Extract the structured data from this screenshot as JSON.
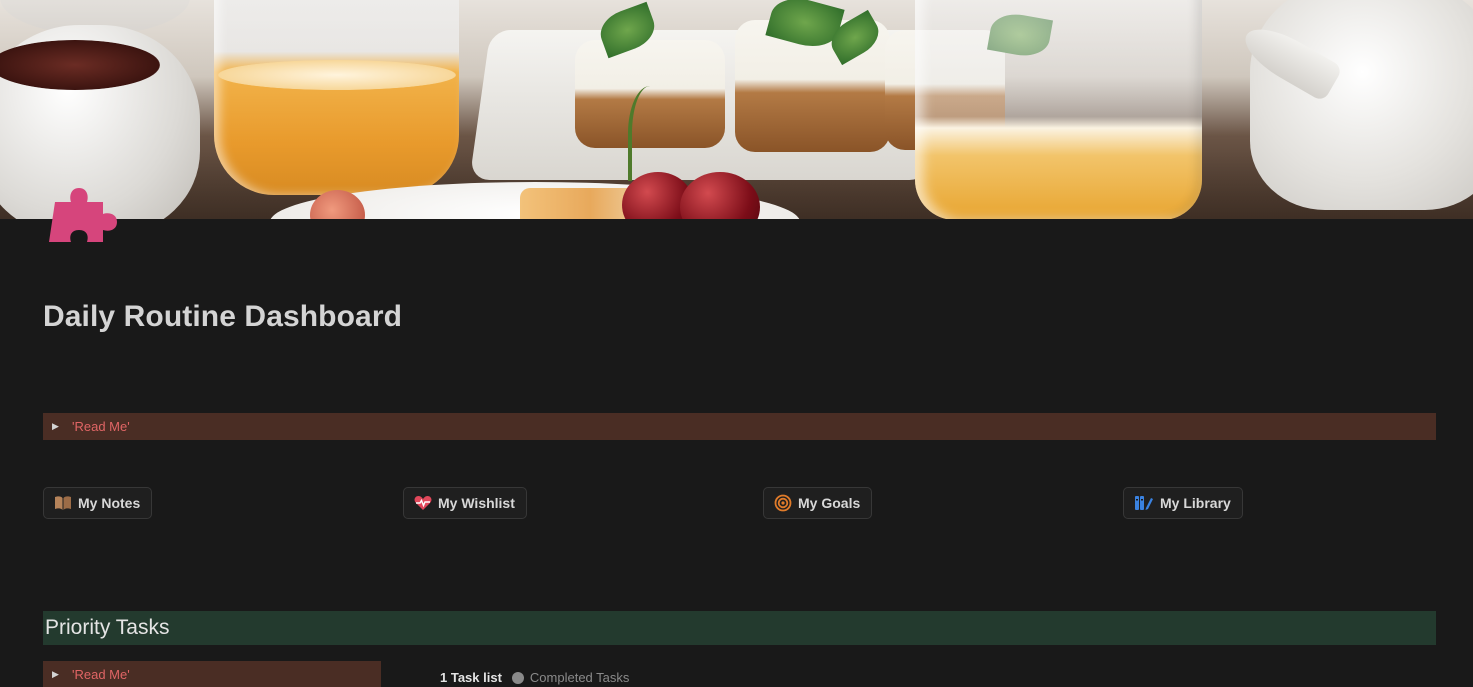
{
  "page": {
    "title": "Daily Routine Dashboard",
    "icon": "puzzle-piece-icon",
    "icon_color": "#d6457c",
    "cover": "breakfast-photo"
  },
  "read_me_toggle": {
    "label": "'Read Me'"
  },
  "links": [
    {
      "label": "My Notes",
      "icon": "open-book-icon",
      "icon_color": "#b5835a"
    },
    {
      "label": "My Wishlist",
      "icon": "heart-pulse-icon",
      "icon_color": "#e0475a"
    },
    {
      "label": "My Goals",
      "icon": "target-icon",
      "icon_color": "#e07b2a"
    },
    {
      "label": "My Library",
      "icon": "books-pencil-icon",
      "icon_color": "#3a82e0"
    }
  ],
  "priority_section": {
    "heading": "Priority Tasks",
    "read_me_label": "'Read Me'",
    "views": [
      "1 Task list",
      "Completed Tasks"
    ]
  },
  "colors": {
    "background": "#191919",
    "toggle_bg": "#4a2d24",
    "toggle_text": "#e06565",
    "section_bg": "#233a2e"
  }
}
